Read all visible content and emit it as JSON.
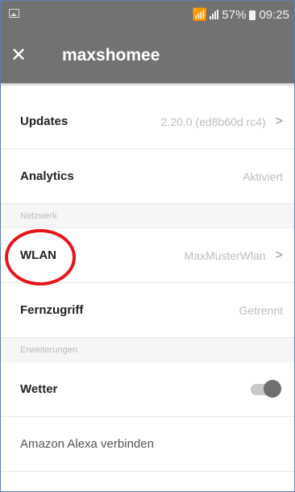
{
  "statusbar": {
    "battery": "57%",
    "time": "09:25"
  },
  "appbar": {
    "close": "✕",
    "title": "maxshomee"
  },
  "rows": [
    {
      "label": "Updates",
      "value": "2.20.0 (ed8b60d rc4)"
    },
    {
      "label": "Analytics",
      "value": "Aktiviert"
    }
  ],
  "sections": {
    "netzwerk": "Netzwerk",
    "erweiterungen": "Erweiterungen"
  },
  "netzwerk_rows": [
    {
      "label": "WLAN",
      "value": "MaxMusterWlan"
    },
    {
      "label": "Fernzugriff",
      "value": "Getrennt"
    }
  ],
  "erweiterungen_rows": [
    {
      "label": "Wetter",
      "toggle_on": true
    },
    {
      "label": "Amazon Alexa verbinden"
    }
  ],
  "annotation_color": "#e8141b"
}
